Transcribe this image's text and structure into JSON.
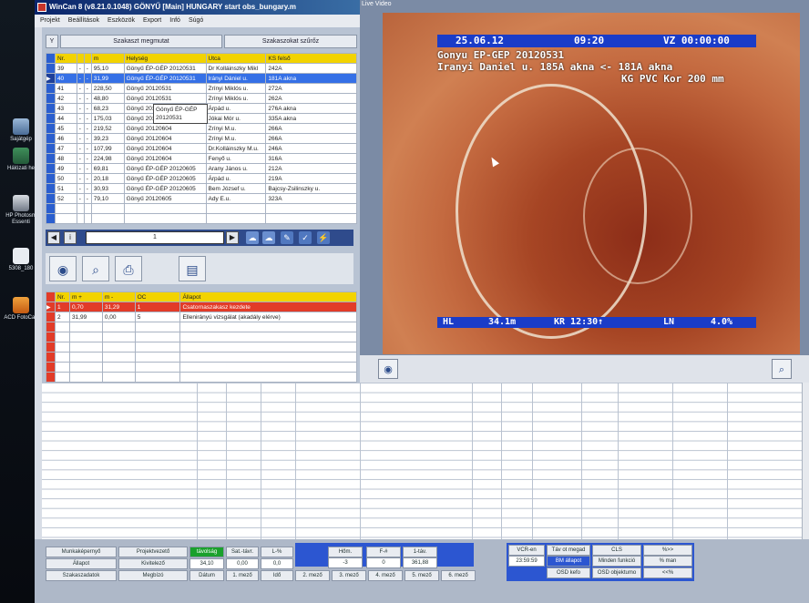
{
  "desktop": {
    "icons": [
      {
        "label": "Sajátgép",
        "icon": "computer-icon"
      },
      {
        "label": "Hálózati he",
        "icon": "network-icon"
      },
      {
        "label": "HP Photosm Essenti",
        "icon": "photosmart-icon"
      },
      {
        "label": "5308_180",
        "icon": "file-icon"
      },
      {
        "label": "ACD FotoCan",
        "icon": "acd-icon"
      }
    ]
  },
  "window": {
    "title": "WinCan 8  (v8.21.0.1048) GÖNYŰ [Main] HUNGARY start obs_bungary.m",
    "menu": [
      "Projekt",
      "Beállítások",
      "Eszközök",
      "Export",
      "Infó",
      "Súgó"
    ]
  },
  "sections": {
    "filter_show": "Szakaszt megmutat",
    "filter_section": "Szakaszokat szűrőz"
  },
  "section_table": {
    "headers": [
      "Nr.",
      "",
      "",
      "m",
      "Helység",
      "Utca",
      "KS felső"
    ],
    "rows": [
      [
        "39",
        "-",
        "-",
        "95,10",
        "Gönyű ÉP-GÉP 20120531",
        "Dr Kolláinszky Mikl",
        "242A"
      ],
      [
        "40",
        "-",
        "-",
        "31,99",
        "Gönyű ÉP-GÉP 20120531",
        "Irányi Dániel u.",
        "181A akna"
      ],
      [
        "41",
        "-",
        "-",
        "228,50",
        "Gönyű 20120531",
        "Zrínyi Miklós u.",
        "272A"
      ],
      [
        "42",
        "-",
        "-",
        "48,80",
        "Gönyű 20120531",
        "Zrínyi Miklós u.",
        "262A"
      ],
      [
        "43",
        "-",
        "-",
        "68,23",
        "Gönyű 20120531",
        "Árpád u.",
        "276A akna"
      ],
      [
        "44",
        "-",
        "-",
        "175,03",
        "Gönyű 20120531",
        "Jókai Mór u.",
        "335A akna"
      ],
      [
        "45",
        "-",
        "-",
        "219,52",
        "Gönyű 20120604",
        "Zrínyi M.u.",
        "266A"
      ],
      [
        "46",
        "-",
        "-",
        "39,23",
        "Gönyű 20120604",
        "Zrínyi M.u.",
        "266A"
      ],
      [
        "47",
        "-",
        "-",
        "107,99",
        "Gönyű 20120604",
        "Dr.Kolláinszky M.u.",
        "246A"
      ],
      [
        "48",
        "-",
        "-",
        "224,98",
        "Gönyű 20120604",
        "Fenyő u.",
        "316A"
      ],
      [
        "49",
        "-",
        "-",
        "69,81",
        "Gönyű ÉP-GÉP 20120605",
        "Arany János u.",
        "212A"
      ],
      [
        "50",
        "-",
        "-",
        "20,18",
        "Gönyű ÉP-GÉP 20120605",
        "Árpád u.",
        "219A"
      ],
      [
        "51",
        "-",
        "-",
        "30,93",
        "Gönyű ÉP-GÉP 20120605",
        "Bem József u.",
        "Bajcsy-Zsilinszky u."
      ],
      [
        "52",
        "-",
        "-",
        "79,10",
        "Gönyű 20120605",
        "Ady E.u.",
        "323A"
      ]
    ],
    "tooltip": "Gönyű ÉP-GÉP 20120531"
  },
  "navigator": {
    "page": "1"
  },
  "observation_table": {
    "headers": [
      "Nr.",
      "m +",
      "m -",
      "OC",
      "Állapot"
    ],
    "rows": [
      [
        "1",
        "0,70",
        "31,29",
        "1",
        "Csatornaszakasz kezdete"
      ],
      [
        "2",
        "31,99",
        "0,00",
        "5",
        "Ellenirányú vizsgálat (akadály elérve)"
      ]
    ]
  },
  "live_video": {
    "label": "Live Video",
    "osd_date": "25.06.12",
    "osd_time": "09:20",
    "osd_vz": "VZ 00:00:00",
    "osd_line1": "Gonyu EP-GEP 20120531",
    "osd_line2": "Iranyi Daniel u.  185A akna <- 181A akna",
    "osd_line3": "KG PVC Kor 200 mm",
    "osd_hl": "HL",
    "osd_dist": "34.1m",
    "osd_kr": "KR 12:30↑",
    "osd_ln": "LN",
    "osd_ln_val": "4.0%"
  },
  "status": {
    "col1": [
      "Munkaképernyő",
      "Állapot",
      "Szakaszadatok"
    ],
    "col2": [
      "Projektvezető",
      "Kivitelező",
      "Megbízó"
    ],
    "col3_label": "távolság",
    "col3_value": "34,10",
    "col3_bottom": "Dátum",
    "col4_label": "Sat.-távr.",
    "col4_value": "0,00",
    "col4_bottom": "1. mező",
    "col5_label": "L-%",
    "col5_value": "0,0",
    "col5_bottom": "Idő",
    "mid_labels": [
      "Hőm.",
      "F-#",
      "1-táv."
    ],
    "mid_values": [
      "-3",
      "0",
      "361,88"
    ],
    "mid_bottom": [
      "2. mező",
      "3. mező",
      "4. mező",
      "5. mező",
      "6. mező"
    ],
    "vcr_label": "VCR-en",
    "vcr_value": "23:59:59",
    "right_buttons": [
      "Táv ot megad",
      "CLS",
      "%>>",
      "BM állapot",
      "Minden funkció",
      "% man",
      "OSD kefo",
      "OSD objektumo",
      "<<%"
    ]
  },
  "colors": {
    "selection_blue": "#3570e6",
    "header_yellow": "#f2d300",
    "obs_red": "#e23b28",
    "osd_blue": "#1a3cc8"
  }
}
